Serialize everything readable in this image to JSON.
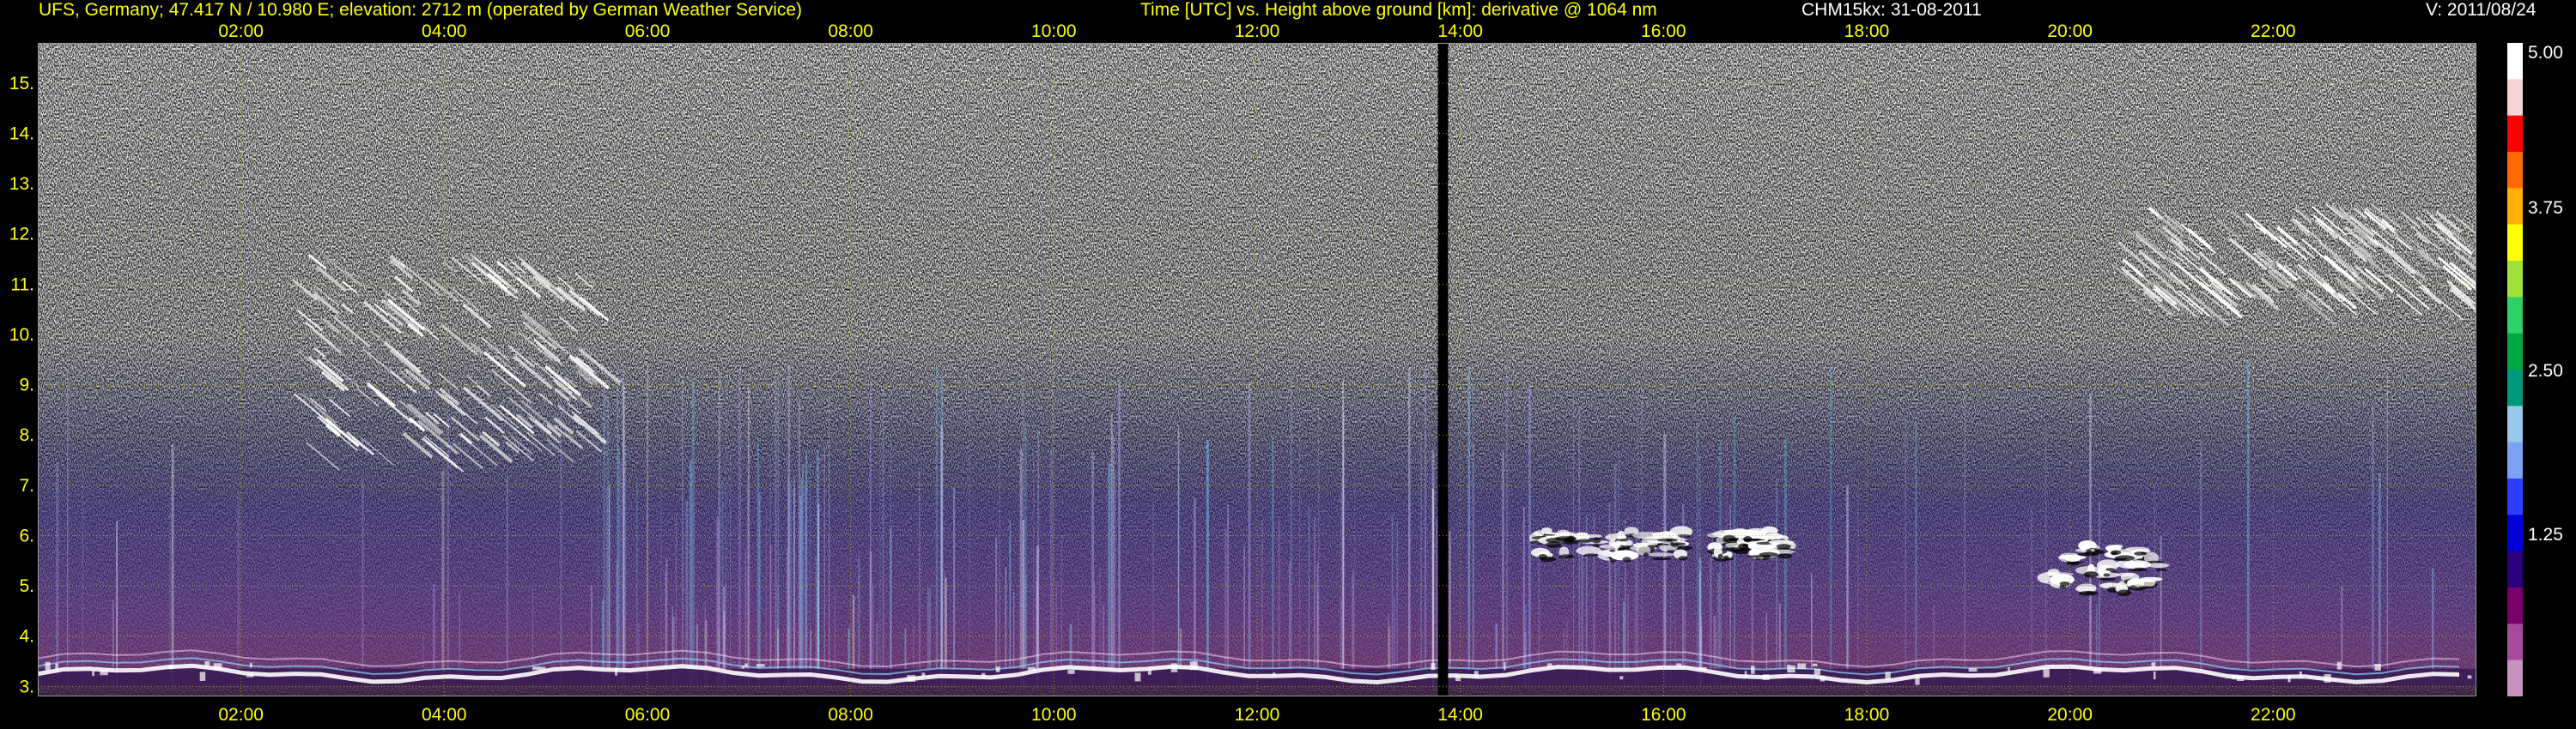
{
  "header": {
    "station_text": "UFS, Germany; 47.417 N / 10.980 E; elevation: 2712 m  (operated by German Weather Service)",
    "title_text": "Time [UTC] vs. Height above ground [km]: derivative @ 1064 nm",
    "instrument_text": "CHM15kx: 31-08-2011",
    "version_text": "V: 2011/08/24"
  },
  "colors": {
    "background": "#000000",
    "axis_text": "#ffff00",
    "grid": "#b8b800",
    "frame": "#9a9a9a",
    "header_right": "#ffffff",
    "colorbar_labels": "#ffffff"
  },
  "colorbar": {
    "labels": [
      "5.00",
      "3.75",
      "2.50",
      "1.25"
    ],
    "colors": [
      "#ffffff",
      "#f4d4d4",
      "#ff0000",
      "#ff6a00",
      "#ffb000",
      "#ffff00",
      "#9ee23a",
      "#2fd06a",
      "#00a843",
      "#00987a",
      "#98c8ea",
      "#7ea0f2",
      "#2a3fff",
      "#0000d6",
      "#28007a",
      "#7a006e",
      "#a64aa0",
      "#c693c0"
    ]
  },
  "chart_data": {
    "type": "heatmap",
    "title": "Time [UTC] vs. Height above ground [km]: derivative @ 1064 nm",
    "xlabel": "Time [UTC]",
    "ylabel": "Height above ground [km]",
    "x_ticks": [
      "02:00",
      "04:00",
      "06:00",
      "08:00",
      "10:00",
      "12:00",
      "14:00",
      "16:00",
      "18:00",
      "20:00",
      "22:00"
    ],
    "x_tick_hours": [
      2,
      4,
      6,
      8,
      10,
      12,
      14,
      16,
      18,
      20,
      22
    ],
    "y_ticks": [
      "3.",
      "4.",
      "5.",
      "6.",
      "7.",
      "8.",
      "9.",
      "10.",
      "11.",
      "12.",
      "13.",
      "14.",
      "15."
    ],
    "y_tick_values": [
      3,
      4,
      5,
      6,
      7,
      8,
      9,
      10,
      11,
      12,
      13,
      14,
      15
    ],
    "xlim": [
      0,
      24
    ],
    "ylim": [
      2.8,
      15.8
    ],
    "grid": true,
    "colorbar_range": [
      0,
      5
    ],
    "colorbar_ticks": [
      1.25,
      2.5,
      3.75,
      5.0
    ],
    "data_gap": {
      "start_hour": 13.78,
      "end_hour": 13.88
    },
    "features": [
      {
        "name": "cirrus",
        "hour_start": 2.5,
        "hour_end": 5.4,
        "height_bottom": 7.8,
        "height_top": 11.6
      },
      {
        "name": "cirrus",
        "hour_start": 20.4,
        "hour_end": 23.9,
        "height_bottom": 10.8,
        "height_top": 12.6
      },
      {
        "name": "cloud",
        "hour_start": 14.7,
        "hour_end": 16.2,
        "height_bottom": 5.6,
        "height_top": 6.1
      },
      {
        "name": "cloud",
        "hour_start": 16.5,
        "hour_end": 17.2,
        "height_bottom": 5.6,
        "height_top": 6.1
      },
      {
        "name": "cloud",
        "hour_start": 19.8,
        "hour_end": 20.9,
        "height_bottom": 4.9,
        "height_top": 5.8
      },
      {
        "name": "boundary-layer",
        "hour_start": 0.0,
        "hour_end": 24.0,
        "height_bottom": 3.0,
        "height_top": 4.1
      }
    ]
  }
}
